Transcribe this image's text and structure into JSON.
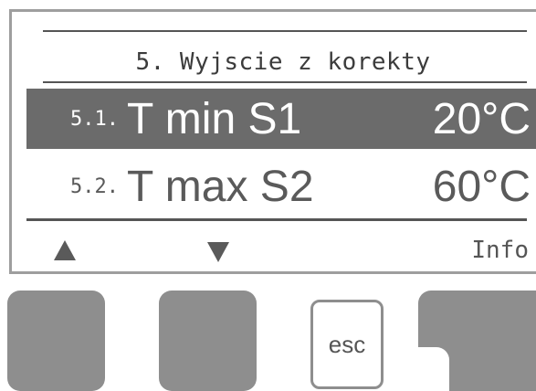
{
  "menu": {
    "title": "5. Wyjscie z korekty",
    "rows": [
      {
        "number": "5.1.",
        "label": "T min S1",
        "value": "20°C",
        "selected": true
      },
      {
        "number": "5.2.",
        "label": "T max S2",
        "value": "60°C",
        "selected": false
      }
    ]
  },
  "softkeys": {
    "up_icon": "triangle-up-icon",
    "down_icon": "triangle-down-icon",
    "right_label": "Info"
  },
  "hardware": {
    "center_button_label": "esc"
  },
  "colors": {
    "selected_row_bg": "#6b6b6b",
    "button_gray": "#8e8e8e",
    "text_dark": "#555555"
  }
}
